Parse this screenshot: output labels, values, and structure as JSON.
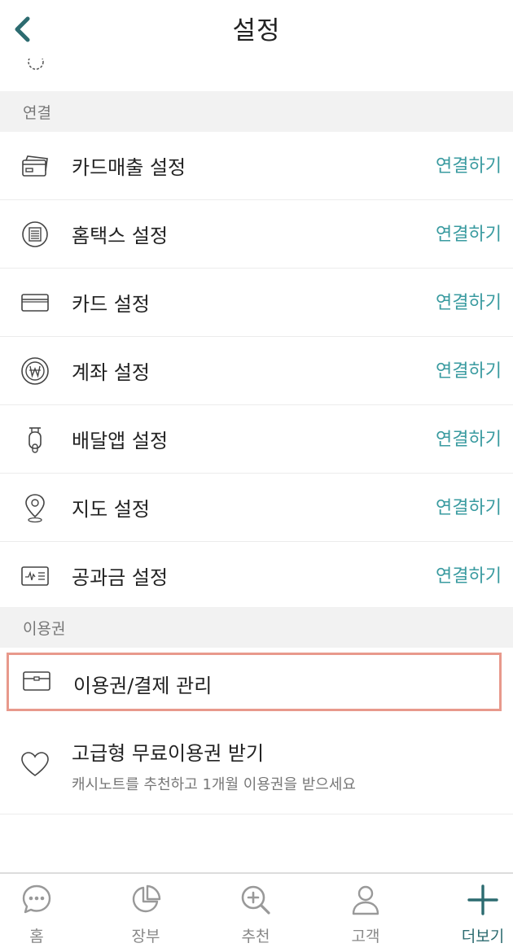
{
  "header": {
    "title": "설정"
  },
  "connect_section": {
    "label": "연결"
  },
  "connect_items": [
    {
      "label": "카드매출 설정",
      "action": "연결하기"
    },
    {
      "label": "홈택스 설정",
      "action": "연결하기"
    },
    {
      "label": "카드 설정",
      "action": "연결하기"
    },
    {
      "label": "계좌 설정",
      "action": "연결하기"
    },
    {
      "label": "배달앱 설정",
      "action": "연결하기"
    },
    {
      "label": "지도 설정",
      "action": "연결하기"
    },
    {
      "label": "공과금 설정",
      "action": "연결하기"
    }
  ],
  "pass_section": {
    "label": "이용권"
  },
  "pass_items": {
    "manage": {
      "label": "이용권/결제 관리"
    },
    "promo": {
      "label": "고급형 무료이용권 받기",
      "subtitle": "캐시노트를 추천하고 1개월 이용권을 받으세요"
    }
  },
  "tabbar": [
    {
      "label": "홈",
      "icon": "chat-bubble-icon"
    },
    {
      "label": "장부",
      "icon": "pie-chart-icon"
    },
    {
      "label": "추천",
      "icon": "zoom-in-icon"
    },
    {
      "label": "고객",
      "icon": "person-icon"
    },
    {
      "label": "더보기",
      "icon": "plus-icon",
      "active": true
    }
  ],
  "colors": {
    "accent": "#3a9ba0",
    "active_tab": "#2c6b70",
    "highlight_border": "#e8998c",
    "section_bg": "#f2f2f2"
  }
}
